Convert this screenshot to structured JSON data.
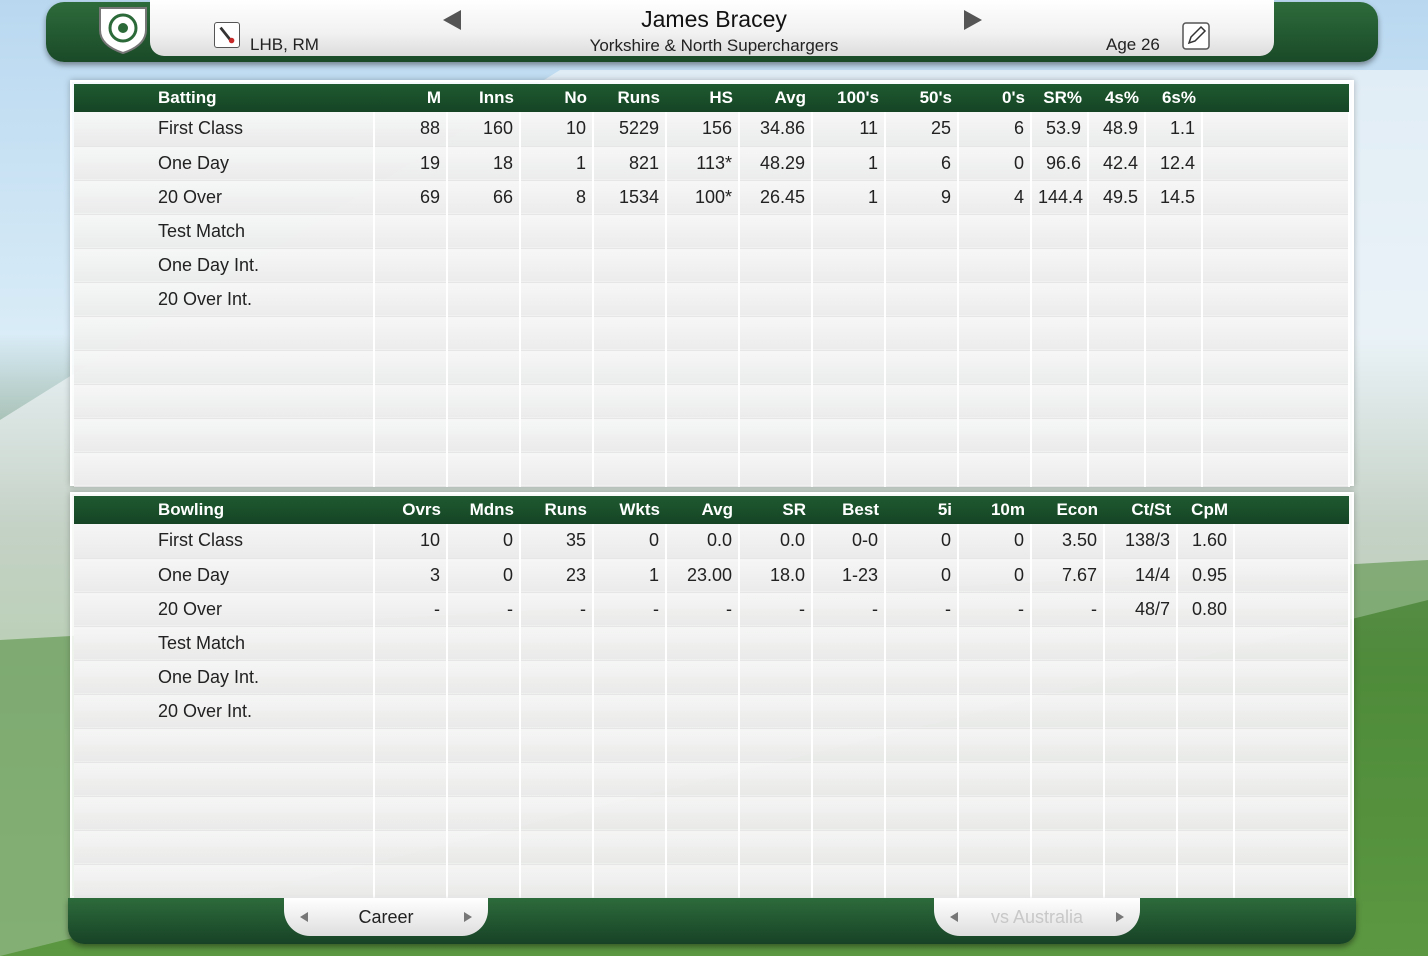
{
  "header": {
    "player_name": "James Bracey",
    "team": "Yorkshire & North Superchargers",
    "handedness": "LHB, RM",
    "age": "Age 26",
    "icons": [
      "crest-icon",
      "bat-ball-icon",
      "prev-arrow-icon",
      "next-arrow-icon",
      "edit-icon"
    ]
  },
  "batting": {
    "columns": [
      "Batting",
      "M",
      "Inns",
      "No",
      "Runs",
      "HS",
      "Avg",
      "100's",
      "50's",
      "0's",
      "SR%",
      "4s%",
      "6s%",
      ""
    ],
    "rows": [
      [
        "First Class",
        "88",
        "160",
        "10",
        "5229",
        "156",
        "34.86",
        "11",
        "25",
        "6",
        "53.9",
        "48.9",
        "1.1",
        ""
      ],
      [
        "One Day",
        "19",
        "18",
        "1",
        "821",
        "113*",
        "48.29",
        "1",
        "6",
        "0",
        "96.6",
        "42.4",
        "12.4",
        ""
      ],
      [
        "20 Over",
        "69",
        "66",
        "8",
        "1534",
        "100*",
        "26.45",
        "1",
        "9",
        "4",
        "144.4",
        "49.5",
        "14.5",
        ""
      ],
      [
        "Test Match",
        "",
        "",
        "",
        "",
        "",
        "",
        "",
        "",
        "",
        "",
        "",
        "",
        ""
      ],
      [
        "One Day Int.",
        "",
        "",
        "",
        "",
        "",
        "",
        "",
        "",
        "",
        "",
        "",
        "",
        ""
      ],
      [
        "20 Over Int.",
        "",
        "",
        "",
        "",
        "",
        "",
        "",
        "",
        "",
        "",
        "",
        "",
        ""
      ],
      [
        "",
        "",
        "",
        "",
        "",
        "",
        "",
        "",
        "",
        "",
        "",
        "",
        "",
        ""
      ],
      [
        "",
        "",
        "",
        "",
        "",
        "",
        "",
        "",
        "",
        "",
        "",
        "",
        "",
        ""
      ],
      [
        "",
        "",
        "",
        "",
        "",
        "",
        "",
        "",
        "",
        "",
        "",
        "",
        "",
        ""
      ],
      [
        "",
        "",
        "",
        "",
        "",
        "",
        "",
        "",
        "",
        "",
        "",
        "",
        "",
        ""
      ],
      [
        "",
        "",
        "",
        "",
        "",
        "",
        "",
        "",
        "",
        "",
        "",
        "",
        "",
        ""
      ]
    ]
  },
  "bowling": {
    "columns": [
      "Bowling",
      "Ovrs",
      "Mdns",
      "Runs",
      "Wkts",
      "Avg",
      "SR",
      "Best",
      "5i",
      "10m",
      "Econ",
      "Ct/St",
      "CpM",
      ""
    ],
    "rows": [
      [
        "First Class",
        "10",
        "0",
        "35",
        "0",
        "0.0",
        "0.0",
        "0-0",
        "0",
        "0",
        "3.50",
        "138/3",
        "1.60",
        ""
      ],
      [
        "One Day",
        "3",
        "0",
        "23",
        "1",
        "23.00",
        "18.0",
        "1-23",
        "0",
        "0",
        "7.67",
        "14/4",
        "0.95",
        ""
      ],
      [
        "20 Over",
        "-",
        "-",
        "-",
        "-",
        "-",
        "-",
        "-",
        "-",
        "-",
        "-",
        "48/7",
        "0.80",
        ""
      ],
      [
        "Test Match",
        "",
        "",
        "",
        "",
        "",
        "",
        "",
        "",
        "",
        "",
        "",
        "",
        ""
      ],
      [
        "One Day Int.",
        "",
        "",
        "",
        "",
        "",
        "",
        "",
        "",
        "",
        "",
        "",
        "",
        ""
      ],
      [
        "20 Over Int.",
        "",
        "",
        "",
        "",
        "",
        "",
        "",
        "",
        "",
        "",
        "",
        "",
        ""
      ],
      [
        "",
        "",
        "",
        "",
        "",
        "",
        "",
        "",
        "",
        "",
        "",
        "",
        "",
        ""
      ],
      [
        "",
        "",
        "",
        "",
        "",
        "",
        "",
        "",
        "",
        "",
        "",
        "",
        "",
        ""
      ],
      [
        "",
        "",
        "",
        "",
        "",
        "",
        "",
        "",
        "",
        "",
        "",
        "",
        "",
        ""
      ],
      [
        "",
        "",
        "",
        "",
        "",
        "",
        "",
        "",
        "",
        "",
        "",
        "",
        "",
        ""
      ],
      [
        "",
        "",
        "",
        "",
        "",
        "",
        "",
        "",
        "",
        "",
        "",
        "",
        "",
        ""
      ]
    ]
  },
  "footer": {
    "career_tab": "Career",
    "vs_tab": "vs Australia"
  },
  "colors": {
    "header_green": "#1f5a30",
    "panel_white": "#ffffff"
  }
}
